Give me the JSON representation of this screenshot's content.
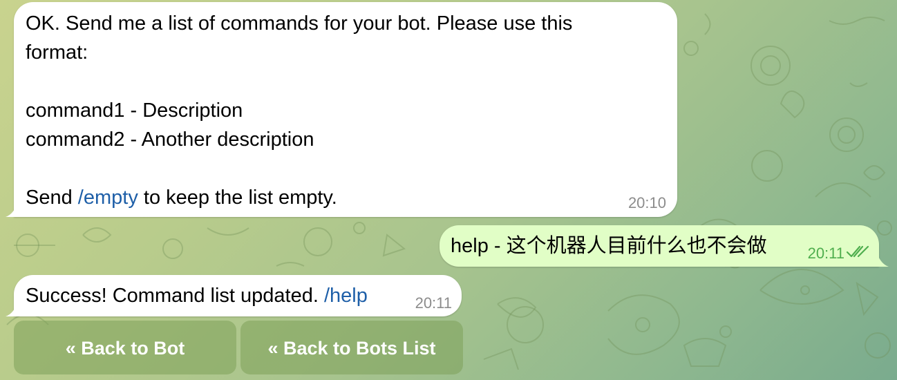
{
  "messages": {
    "instructions": {
      "lines": [
        "OK. Send me a list of commands for your bot. Please use this",
        "format:",
        "",
        "command1 - Description",
        "command2 - Another description",
        ""
      ],
      "last_line_prefix": "Send ",
      "last_line_link": "/empty",
      "last_line_suffix": " to keep the list empty.",
      "time": "20:10"
    },
    "outgoing": {
      "text": "help - 这个机器人目前什么也不会做",
      "time": "20:11",
      "status_icon": "double-check-read-icon"
    },
    "success": {
      "text": "Success! Command list updated. ",
      "link": "/help",
      "time": "20:11"
    }
  },
  "inline_keyboard": [
    {
      "label": "« Back to Bot"
    },
    {
      "label": "« Back to Bots List"
    }
  ],
  "colors": {
    "incoming_bubble": "#ffffff",
    "outgoing_bubble": "#e1fec6",
    "link": "#1e5fa8",
    "outgoing_time": "#4fae4e",
    "incoming_time": "#8c8c8c",
    "keyboard_button": "#7ea05a"
  }
}
